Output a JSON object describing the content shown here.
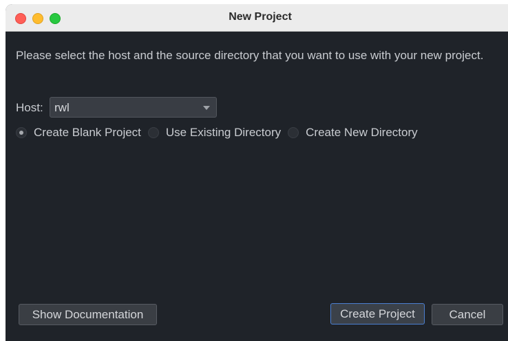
{
  "window": {
    "title": "New Project"
  },
  "dialog": {
    "message": "Please select the host and the source directory that you want to use with your new project.",
    "host_label": "Host:",
    "host_value": "rwl",
    "radio_options": [
      {
        "label": "Create Blank Project",
        "checked": true
      },
      {
        "label": "Use Existing Directory",
        "checked": false
      },
      {
        "label": "Create New Directory",
        "checked": false
      }
    ]
  },
  "buttons": {
    "show_documentation": "Show Documentation",
    "create_project": "Create Project",
    "cancel": "Cancel"
  },
  "colors": {
    "background": "#1f2329",
    "text": "#c9ccd1",
    "focus_border": "#4b7fd1",
    "close": "#ff5f57",
    "minimize": "#febc2e",
    "maximize": "#28c840"
  }
}
